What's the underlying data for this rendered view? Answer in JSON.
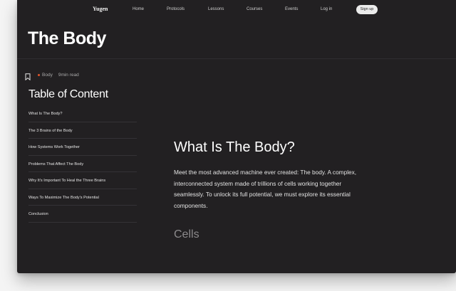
{
  "nav": {
    "logo": "Yugen",
    "links": [
      "Home",
      "Protocols",
      "Lessons",
      "Courses",
      "Events",
      "Log in"
    ],
    "signup_label": "Sign up"
  },
  "page": {
    "title": "The Body"
  },
  "meta": {
    "category": "Body",
    "read_time": "9min read",
    "category_dot_color": "#e0552b"
  },
  "toc": {
    "title": "Table of Content",
    "items": [
      "What Is The Body?",
      "The 3 Brains of the Body",
      "How Systems Work Together",
      "Problems That Affect The Body",
      "Why It's Important To Heal the Three Brains",
      "Ways To Maximize The Body's Potential",
      "Conclusion"
    ]
  },
  "article": {
    "heading": "What Is The Body?",
    "body": "Meet the most advanced machine ever created: The body. A complex, interconnected system made of trillions of cells working together seamlessly. To unlock its full potential, we must explore its essential components.",
    "subheading": "Cells"
  },
  "colors": {
    "background": "#222022",
    "accent": "#e0552b",
    "signup_button": "#ebebeb"
  },
  "icons": {
    "bookmark": "bookmark-icon"
  }
}
